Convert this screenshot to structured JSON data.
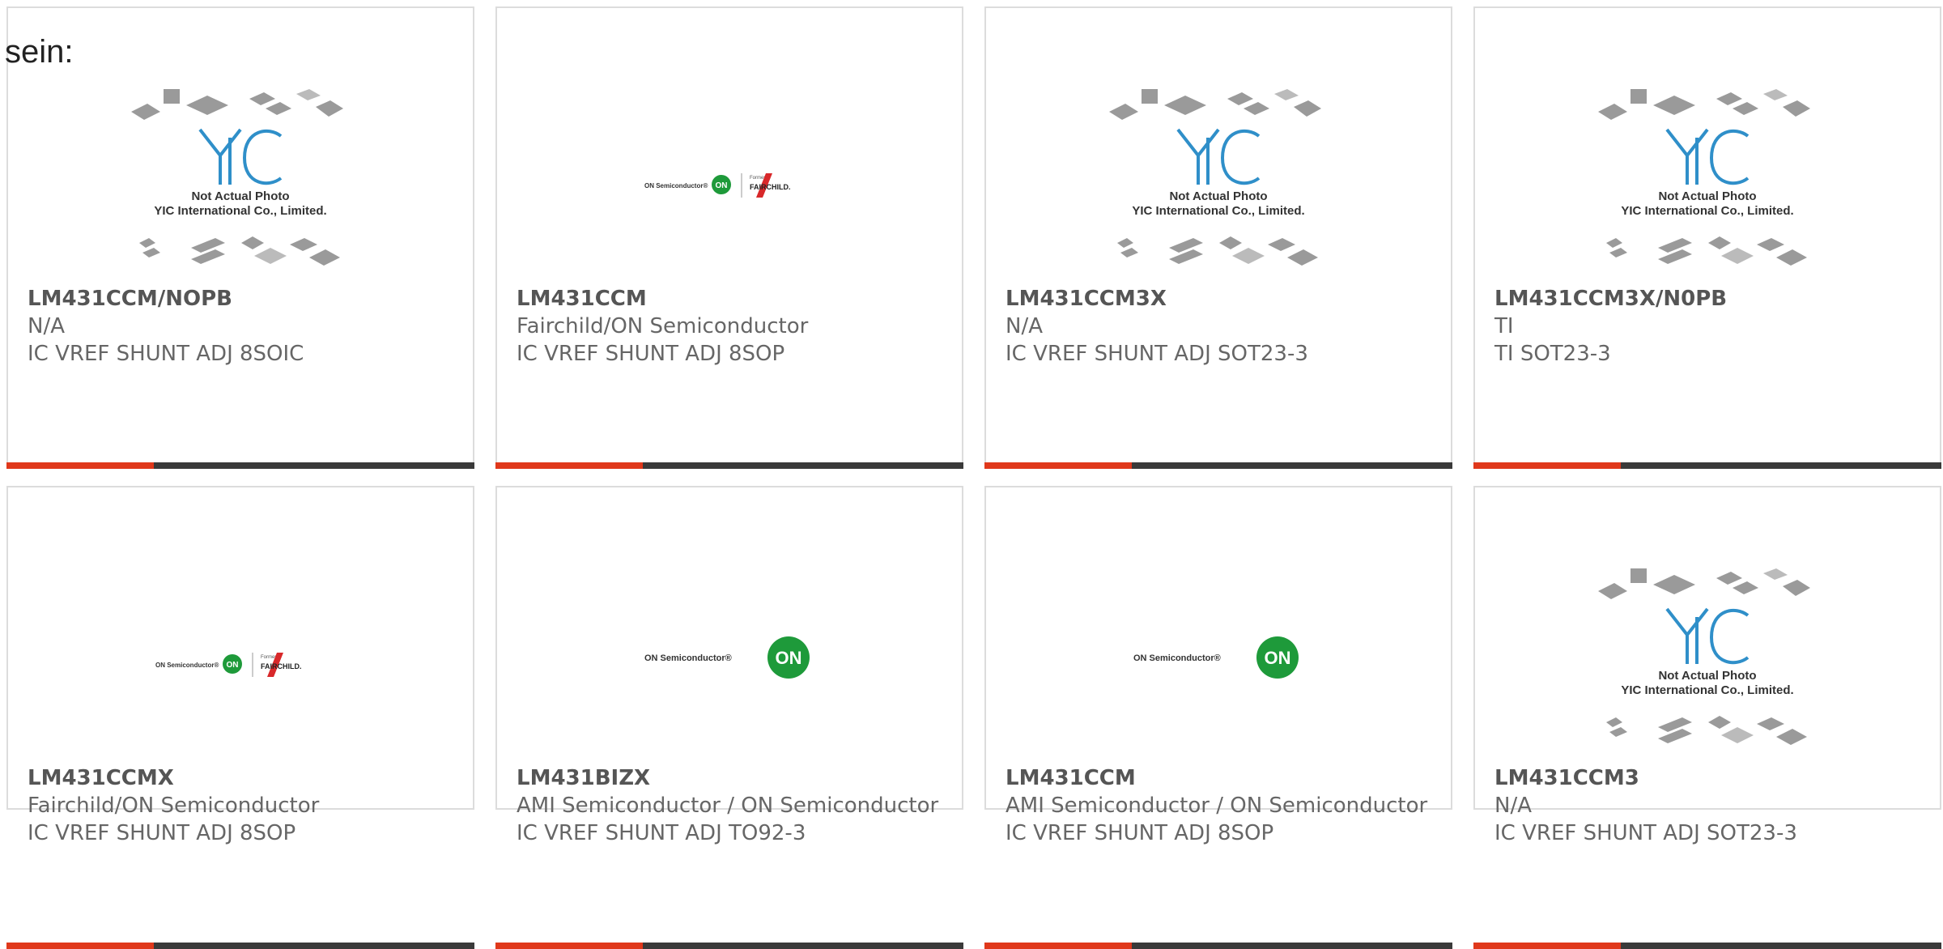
{
  "fragment_text": "sein:",
  "colors": {
    "accent_bar": "#e0381b",
    "dark_bar": "#3a3a3a",
    "on_green": "#1e9a3a",
    "fairchild_red": "#d8282a",
    "yic_blue": "#2f8fc9"
  },
  "yic_image": {
    "line1": "Not Actual Photo",
    "line2": "YIC International Co., Limited."
  },
  "logos": {
    "on_text": "ON Semiconductor®",
    "on_badge": "ON",
    "formerly": "Formerly",
    "fairchild": "FAIRCHILD."
  },
  "products": [
    {
      "part": "LM431CCM/NOPB",
      "manufacturer": "N/A",
      "description": "IC VREF SHUNT ADJ 8SOIC",
      "image": "yic-placeholder"
    },
    {
      "part": "LM431CCM",
      "manufacturer": "Fairchild/ON Semiconductor",
      "description": "IC VREF SHUNT ADJ 8SOP",
      "image": "fairchild-on-logo"
    },
    {
      "part": "LM431CCM3X",
      "manufacturer": "N/A",
      "description": "IC VREF SHUNT ADJ SOT23-3",
      "image": "yic-placeholder"
    },
    {
      "part": "LM431CCM3X/N0PB",
      "manufacturer": "TI",
      "description": "TI SOT23-3",
      "image": "yic-placeholder"
    },
    {
      "part": "LM431CCMX",
      "manufacturer": "Fairchild/ON Semiconductor",
      "description": "IC VREF SHUNT ADJ 8SOP",
      "image": "fairchild-on-logo"
    },
    {
      "part": "LM431BIZX",
      "manufacturer": "AMI Semiconductor / ON Semiconductor",
      "description": "IC VREF SHUNT ADJ TO92-3",
      "image": "on-semi-logo"
    },
    {
      "part": "LM431CCM",
      "manufacturer": "AMI Semiconductor / ON Semiconductor",
      "description": "IC VREF SHUNT ADJ 8SOP",
      "image": "on-semi-logo"
    },
    {
      "part": "LM431CCM3",
      "manufacturer": "N/A",
      "description": "IC VREF SHUNT ADJ SOT23-3",
      "image": "yic-placeholder"
    }
  ]
}
